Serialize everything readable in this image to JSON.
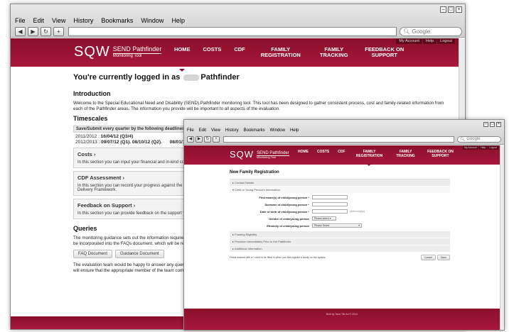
{
  "window1": {
    "menu": [
      "File",
      "Edit",
      "View",
      "History",
      "Bookmarks",
      "Window",
      "Help"
    ],
    "search_placeholder": "Google",
    "site": {
      "logo": "SQW",
      "logo_sub1": "SEND Pathfinder",
      "logo_sub2": "Monitoring Tool",
      "account_links": [
        "My Account",
        "Help",
        "Logout"
      ],
      "nav": [
        "HOME",
        "COSTS",
        "CDF",
        "FAMILY REGISTRATION",
        "FAMILY TRACKING",
        "FEEDBACK ON SUPPORT"
      ]
    },
    "page": {
      "welcome_pre": "You're currently logged in as",
      "welcome_post": "Pathfinder",
      "intro_heading": "Introduction",
      "intro_text": "Welcome to the Special Educational Need and Disability (SEND) Pathfinder monitoring tool. This tool has been designed to gather consistent process, cost and family-related information from each of the Pathfinder areas. The information you provide will be important to all aspects of the evaluation.",
      "timescales_heading": "Timescales",
      "timescales_bar": "Save/Submit every quarter by the following deadlines",
      "ts_row1_label": "2011/2012 : ",
      "ts_row1_value": "16/04/12 (Q3/4)",
      "ts_row2_label": "2012/2013 : ",
      "ts_row2_value": "09/07/12 (Q1).",
      "ts_row2_rest": "08/10/12 (Q2).      08/01/13 (Q",
      "panels": [
        {
          "title": "Costs ›",
          "text": "In this section you can input your financial and in-kind cos"
        },
        {
          "title": "CDF Assessment ›",
          "text": "In this section you can record your progress against the Pa",
          "text2": "Delivery Framework."
        },
        {
          "title": "Feedback on Support ›",
          "text": "In this section you can provide feedback on the support yo"
        }
      ],
      "queries_heading": "Queries",
      "queries_text1": "The monitoring guidance sets out the information requiremen",
      "queries_text2": "be incorporated into the FAQs document, which will be regula",
      "faq_button": "FAQ Document",
      "guidance_button": "Guidance Document",
      "evaluation_text1": "The evaluation team would be happy to answer any queries yo",
      "evaluation_text2": "will ensure that the appropriate member of the team comes ba"
    }
  },
  "window2": {
    "menu": [
      "File",
      "Edit",
      "View",
      "History",
      "Bookmarks",
      "Window",
      "Help"
    ],
    "search_placeholder": "Google",
    "site": {
      "logo": "SQW",
      "logo_sub1": "SEND Pathfinder",
      "logo_sub2": "Monitoring Tool",
      "account_links": [
        "My Account",
        "Help",
        "Logout"
      ],
      "nav": [
        "HOME",
        "COSTS",
        "CDF",
        "FAMILY REGISTRATION",
        "FAMILY TRACKING",
        "FEEDBACK ON SUPPORT"
      ]
    },
    "page": {
      "title": "New Family Registration",
      "sections": {
        "contact": "Contact Details",
        "child": "Child or Young Person's Information",
        "funding": "Funding Eligibility",
        "provision": "Provision Immediately Prior to the Pathfinder",
        "additional": "Additional Information"
      },
      "fields": {
        "first_name": "First name(s) of child/young person *",
        "surname": "Surname of child/young person *",
        "dob": "Date of birth of child/young person *",
        "dob_hint": "(dd/mm/yyyy)",
        "gender": "Gender of child/young person",
        "gender_value": "Please select",
        "ethnicity": "Ethnicity of child/young person",
        "ethnicity_value": "Please Select"
      },
      "required_note": "Fields marked with a * need to be filled in when you first register a family on the system",
      "cancel_button": "Cancel",
      "save_button": "Save",
      "footer": "Built by Tarot Tile Art © 2013"
    }
  }
}
